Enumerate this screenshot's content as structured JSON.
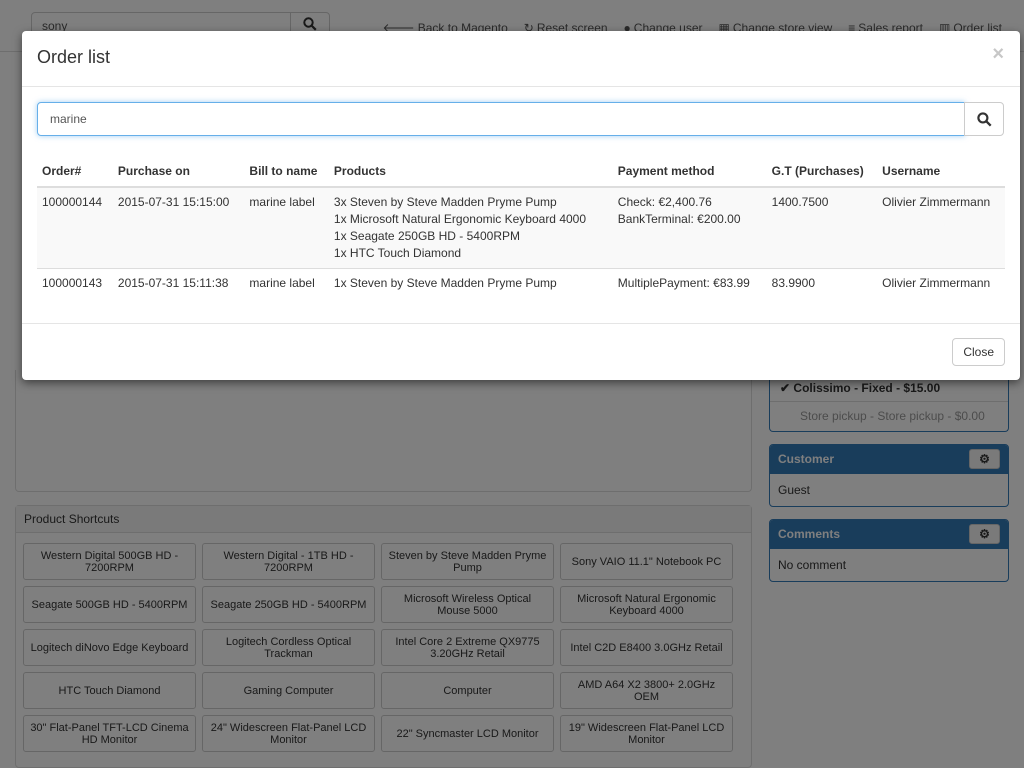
{
  "background": {
    "search_value": "sony",
    "topnav": [
      {
        "icon": "arrow-left-icon",
        "label": "Back to Magento"
      },
      {
        "icon": "refresh-icon",
        "label": "Reset screen"
      },
      {
        "icon": "user-icon",
        "label": "Change user"
      },
      {
        "icon": "store-icon",
        "label": "Change store view"
      },
      {
        "icon": "list-icon",
        "label": "Sales report"
      },
      {
        "icon": "bar-chart-icon",
        "label": "Order list"
      }
    ],
    "shipping": {
      "selected": "Colissimo - Fixed - $15.00",
      "other": "Store pickup - Store pickup - $0.00"
    },
    "customer": {
      "title": "Customer",
      "value": "Guest"
    },
    "comments": {
      "title": "Comments",
      "value": "No comment"
    },
    "shortcuts": {
      "title": "Product Shortcuts",
      "items": [
        "Western Digital 500GB HD - 7200RPM",
        "Western Digital - 1TB HD - 7200RPM",
        "Steven by Steve Madden Pryme Pump",
        "Sony VAIO 11.1\" Notebook PC",
        "Seagate 500GB HD - 5400RPM",
        "Seagate 250GB HD - 5400RPM",
        "Microsoft Wireless Optical Mouse 5000",
        "Microsoft Natural Ergonomic Keyboard 4000",
        "Logitech diNovo Edge Keyboard",
        "Logitech Cordless Optical Trackman",
        "Intel Core 2 Extreme QX9775 3.20GHz Retail",
        "Intel C2D E8400 3.0GHz Retail",
        "HTC Touch Diamond",
        "Gaming Computer",
        "Computer",
        "AMD A64 X2 3800+ 2.0GHz OEM",
        "30\" Flat-Panel TFT-LCD Cinema HD Monitor",
        "24\" Widescreen Flat-Panel LCD Monitor",
        "22\" Syncmaster LCD Monitor",
        "19\" Widescreen Flat-Panel LCD Monitor"
      ]
    }
  },
  "modal": {
    "title": "Order list",
    "close_x": "×",
    "search_value": "marine",
    "columns": [
      "Order#",
      "Purchase on",
      "Bill to name",
      "Products",
      "Payment method",
      "G.T (Purchases)",
      "Username"
    ],
    "orders": [
      {
        "order_no": "100000144",
        "purchase_on": "2015-07-31 15:15:00",
        "bill_to": "marine label",
        "products": [
          "3x Steven by Steve Madden Pryme Pump",
          "1x Microsoft Natural Ergonomic Keyboard 4000",
          "1x Seagate 250GB HD - 5400RPM",
          "1x HTC Touch Diamond"
        ],
        "payment": [
          "Check: €2,400.76",
          "BankTerminal: €200.00"
        ],
        "grand_total": "1400.7500",
        "username": "Olivier Zimmermann"
      },
      {
        "order_no": "100000143",
        "purchase_on": "2015-07-31 15:11:38",
        "bill_to": "marine label",
        "products": [
          "1x Steven by Steve Madden Pryme Pump"
        ],
        "payment": [
          "MultiplePayment: €83.99"
        ],
        "grand_total": "83.9900",
        "username": "Olivier Zimmermann"
      }
    ],
    "close_label": "Close"
  }
}
